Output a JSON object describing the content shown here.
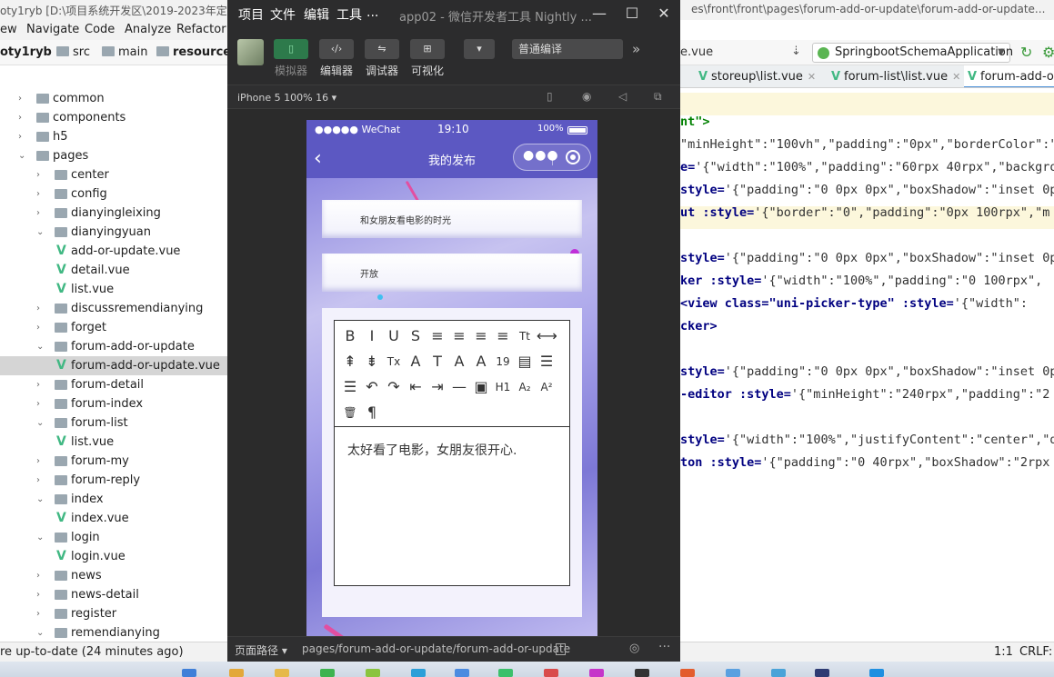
{
  "ide": {
    "title_left": "oty1ryb [D:\\项目系统开发区\\2019-2023年定做",
    "title_right": "es\\front\\front\\pages\\forum-add-or-update\\forum-add-or-update...",
    "menu": [
      "ew",
      "Navigate",
      "Code",
      "Analyze",
      "Refactor"
    ],
    "breadcrumb": [
      "oty1ryb",
      "src",
      "main",
      "resources"
    ],
    "vue_crumb": "e.vue",
    "run_config": "SpringbootSchemaApplication",
    "tabs": [
      "storeup\\list.vue",
      "forum-list\\list.vue",
      "forum-add-o"
    ],
    "tree": [
      {
        "label": "common",
        "type": "folder",
        "expanded": false,
        "level": 0
      },
      {
        "label": "components",
        "type": "folder",
        "expanded": false,
        "level": 0
      },
      {
        "label": "h5",
        "type": "folder",
        "expanded": false,
        "level": 0
      },
      {
        "label": "pages",
        "type": "folder",
        "expanded": true,
        "level": 0
      },
      {
        "label": "center",
        "type": "folder",
        "expanded": false,
        "level": 1
      },
      {
        "label": "config",
        "type": "folder",
        "expanded": false,
        "level": 1
      },
      {
        "label": "dianyingleixing",
        "type": "folder",
        "expanded": false,
        "level": 1
      },
      {
        "label": "dianyingyuan",
        "type": "folder",
        "expanded": true,
        "level": 1
      },
      {
        "label": "add-or-update.vue",
        "type": "vue",
        "level": 2
      },
      {
        "label": "detail.vue",
        "type": "vue",
        "level": 2
      },
      {
        "label": "list.vue",
        "type": "vue",
        "level": 2
      },
      {
        "label": "discussremendianying",
        "type": "folder",
        "expanded": false,
        "level": 1
      },
      {
        "label": "forget",
        "type": "folder",
        "expanded": false,
        "level": 1
      },
      {
        "label": "forum-add-or-update",
        "type": "folder",
        "expanded": true,
        "level": 1
      },
      {
        "label": "forum-add-or-update.vue",
        "type": "vue",
        "level": 2,
        "selected": true
      },
      {
        "label": "forum-detail",
        "type": "folder",
        "expanded": false,
        "level": 1
      },
      {
        "label": "forum-index",
        "type": "folder",
        "expanded": false,
        "level": 1
      },
      {
        "label": "forum-list",
        "type": "folder",
        "expanded": true,
        "level": 1
      },
      {
        "label": "list.vue",
        "type": "vue",
        "level": 2
      },
      {
        "label": "forum-my",
        "type": "folder",
        "expanded": false,
        "level": 1
      },
      {
        "label": "forum-reply",
        "type": "folder",
        "expanded": false,
        "level": 1
      },
      {
        "label": "index",
        "type": "folder",
        "expanded": true,
        "level": 1
      },
      {
        "label": "index.vue",
        "type": "vue",
        "level": 2
      },
      {
        "label": "login",
        "type": "folder",
        "expanded": true,
        "level": 1
      },
      {
        "label": "login.vue",
        "type": "vue",
        "level": 2
      },
      {
        "label": "news",
        "type": "folder",
        "expanded": false,
        "level": 1
      },
      {
        "label": "news-detail",
        "type": "folder",
        "expanded": false,
        "level": 1
      },
      {
        "label": "register",
        "type": "folder",
        "expanded": false,
        "level": 1
      },
      {
        "label": "remendianying",
        "type": "folder",
        "expanded": true,
        "level": 1
      }
    ],
    "code_lines": [
      {
        "text": "nt\">",
        "kind": "str"
      },
      {
        "text": "\"minHeight\":\"100vh\",\"padding\":\"0px\",\"borderColor\":\"",
        "kind": "plain"
      },
      {
        "text": "e='{\"width\":\"100%\",\"padding\":\"60rpx 40rpx\",\"backgrou",
        "kind": "mixed",
        "kw": "e=",
        "rest": "'{\"width\":\"100%\",\"padding\":\"60rpx 40rpx\",\"backgrou"
      },
      {
        "text": "style='{\"padding\":\"0 0px 0px\",\"boxShadow\":\"inset 0p",
        "kind": "mixed",
        "kw": "style=",
        "rest": "'{\"padding\":\"0 0px 0px\",\"boxShadow\":\"inset 0p"
      },
      {
        "text": "ut :style='{\"border\":\"0\",\"padding\":\"0px 100rpx\",\"m",
        "kind": "mixed",
        "kw": "ut :style=",
        "rest": "'{\"border\":\"0\",\"padding\":\"0px 100rpx\",\"m"
      },
      {
        "text": "",
        "kind": "plain"
      },
      {
        "text": "style='{\"padding\":\"0 0px 0px\",\"boxShadow\":\"inset 0p",
        "kind": "mixed",
        "kw": "style=",
        "rest": "'{\"padding\":\"0 0px 0px\",\"boxShadow\":\"inset 0p"
      },
      {
        "text": "ker :style='{\"width\":\"100%\",\"padding\":\"0 100rpx\",",
        "kind": "mixed",
        "kw": "ker :style=",
        "rest": "'{\"width\":\"100%\",\"padding\":\"0 100rpx\","
      },
      {
        "text": "<view class=\"uni-picker-type\" :style='{\"width\":",
        "kind": "mixed",
        "kw": "<view class=\"uni-picker-type\" :style=",
        "rest": "'{\"width\":"
      },
      {
        "text": "cker>",
        "kind": "kwonly"
      },
      {
        "text": "",
        "kind": "plain"
      },
      {
        "text": "style='{\"padding\":\"0 0px 0px\",\"boxShadow\":\"inset 0p",
        "kind": "mixed",
        "kw": "style=",
        "rest": "'{\"padding\":\"0 0px 0px\",\"boxShadow\":\"inset 0p"
      },
      {
        "text": "-editor :style='{\"minHeight\":\"240rpx\",\"padding\":\"2",
        "kind": "mixed",
        "kw": "-editor :style=",
        "rest": "'{\"minHeight\":\"240rpx\",\"padding\":\"2"
      },
      {
        "text": "",
        "kind": "plain"
      },
      {
        "text": "style='{\"width\":\"100%\",\"justifyContent\":\"center\",\"d",
        "kind": "mixed",
        "kw": "style=",
        "rest": "'{\"width\":\"100%\",\"justifyContent\":\"center\",\"d"
      },
      {
        "text": "ton :style='{\"padding\":\"0 40rpx\",\"boxShadow\":\"2rpx",
        "kind": "mixed",
        "kw": "ton :style=",
        "rest": "'{\"padding\":\"0 40rpx\",\"boxShadow\":\"2rpx"
      }
    ],
    "status_left": "re up-to-date (24 minutes ago)",
    "status_pos": "1:1",
    "status_enc": "CRLF:"
  },
  "devtools": {
    "menu": [
      "项目",
      "文件",
      "编辑",
      "工具",
      "..."
    ],
    "app_title": "app02 - 微信开发者工具 Nightly ...",
    "tools": [
      {
        "icon": "phone-icon",
        "label": "模拟器",
        "active": true
      },
      {
        "icon": "code-icon",
        "label": "编辑器"
      },
      {
        "icon": "debug-icon",
        "label": "调试器"
      },
      {
        "icon": "layout-icon",
        "label": "可视化"
      }
    ],
    "compile_mode": "普通编译",
    "device": "iPhone 5 100% 16",
    "page_path_label": "页面路径",
    "page_path": "pages/forum-add-or-update/forum-add-or-update"
  },
  "phone": {
    "carrier": "●●●●● WeChat",
    "time": "19:10",
    "battery": "100%",
    "nav_title": "我的发布",
    "title_value": "和女朋友看电影的时光",
    "type_value": "开放",
    "editor_content": "太好看了电影，女朋友很开心.",
    "editor_tools": [
      "B",
      "I",
      "U",
      "S",
      "≡",
      "≡",
      "≡",
      "≡",
      "Tt",
      "⟷",
      "⇞",
      "⇟",
      "Tx",
      "A",
      "T",
      "A",
      "A",
      "19",
      "▤",
      "☰",
      "☰",
      "↶",
      "↷",
      "⇤",
      "⇥",
      "—",
      "▣",
      "H1",
      "A₂",
      "A²",
      "🗑",
      "¶"
    ]
  }
}
